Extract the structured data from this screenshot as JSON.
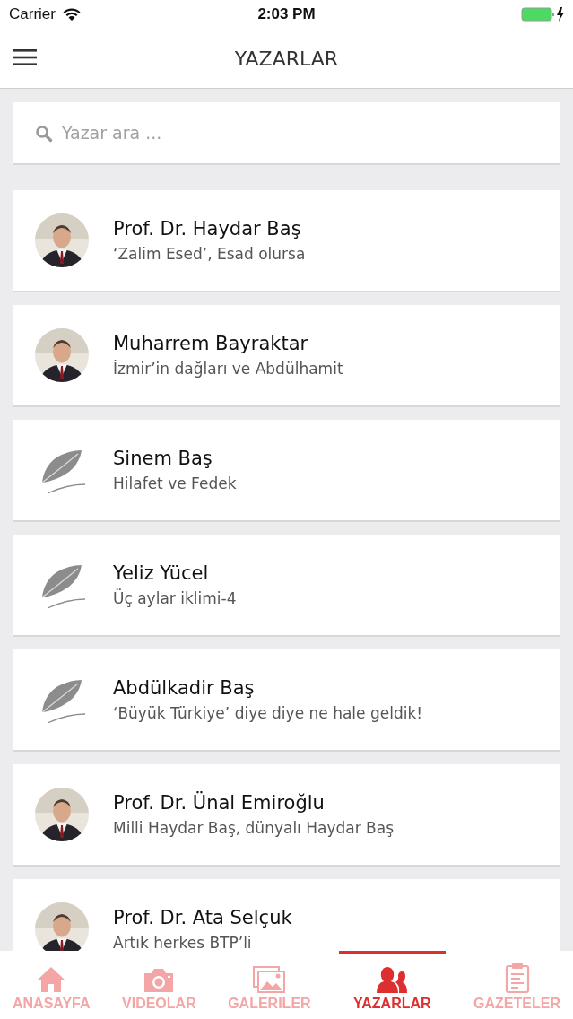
{
  "status_bar": {
    "carrier": "Carrier",
    "time": "2:03 PM"
  },
  "nav": {
    "title": "YAZARLAR"
  },
  "search": {
    "placeholder": "Yazar ara ..."
  },
  "authors": [
    {
      "name": "Prof. Dr. Haydar Baş",
      "article": "‘Zalim Esed’, Esad olursa",
      "kind": "picture"
    },
    {
      "name": "Muharrem Bayraktar",
      "article": "İzmir’in dağları ve Abdülhamit",
      "kind": "picture"
    },
    {
      "name": "Sinem Baş",
      "article": "Hilafet ve Fedek",
      "kind": "placeholder"
    },
    {
      "name": "Yeliz Yücel",
      "article": "Üç aylar iklimi-4",
      "kind": "placeholder"
    },
    {
      "name": "Abdülkadir Baş",
      "article": "‘Büyük Türkiye’ diye diye ne hale geldik!",
      "kind": "placeholder"
    },
    {
      "name": "Prof. Dr. Ünal Emiroğlu",
      "article": "Milli Haydar Baş, dünyalı Haydar Baş",
      "kind": "picture"
    },
    {
      "name": "Prof. Dr. Ata Selçuk",
      "article": "Artık herkes BTP’li",
      "kind": "picture"
    }
  ],
  "tabs": [
    {
      "label": "ANASAYFA",
      "selected": false
    },
    {
      "label": "VIDEOLAR",
      "selected": false
    },
    {
      "label": "GALERILER",
      "selected": false
    },
    {
      "label": "YAZARLAR",
      "selected": true
    },
    {
      "label": "GAZETELER",
      "selected": false
    }
  ]
}
